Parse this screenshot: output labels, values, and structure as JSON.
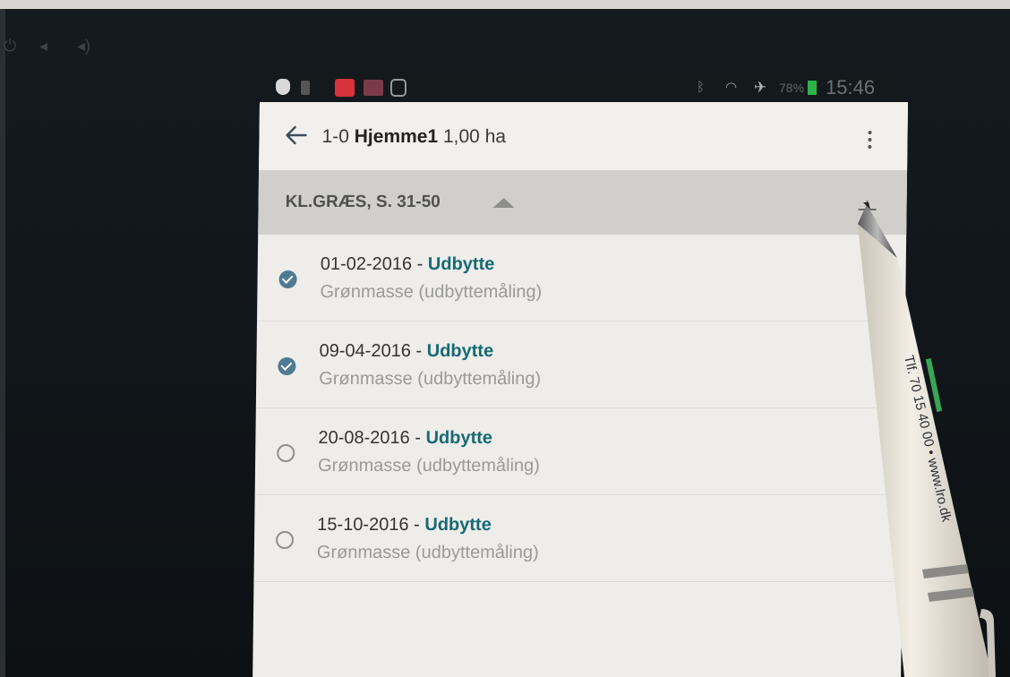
{
  "status_bar": {
    "battery_percent": "78%",
    "time": "15:46"
  },
  "app_bar": {
    "title_prefix": "1-0 ",
    "title_bold": "Hjemme1",
    "title_suffix": " 1,00 ha"
  },
  "section": {
    "title": "KL.GRÆS, S. 31-50"
  },
  "items": [
    {
      "date": "01-02-2016",
      "separator": " - ",
      "kind": "Udbytte",
      "subtitle": "Grønmasse (udbyttemåling)",
      "done": true
    },
    {
      "date": "09-04-2016",
      "separator": " - ",
      "kind": "Udbytte",
      "subtitle": "Grønmasse (udbyttemåling)",
      "done": true
    },
    {
      "date": "20-08-2016",
      "separator": " - ",
      "kind": "Udbytte",
      "subtitle": "Grønmasse (udbyttemåling)",
      "done": false
    },
    {
      "date": "15-10-2016",
      "separator": " - ",
      "kind": "Udbytte",
      "subtitle": "Grønmasse (udbyttemåling)",
      "done": false
    }
  ],
  "pen": {
    "imprint": "Tlf. 70 15 40 00 • www.lro.dk"
  },
  "colors": {
    "accent_teal": "#166a74",
    "check_done": "#4f7a92",
    "battery_green": "#2db34a",
    "notification_red": "#d8323a"
  }
}
